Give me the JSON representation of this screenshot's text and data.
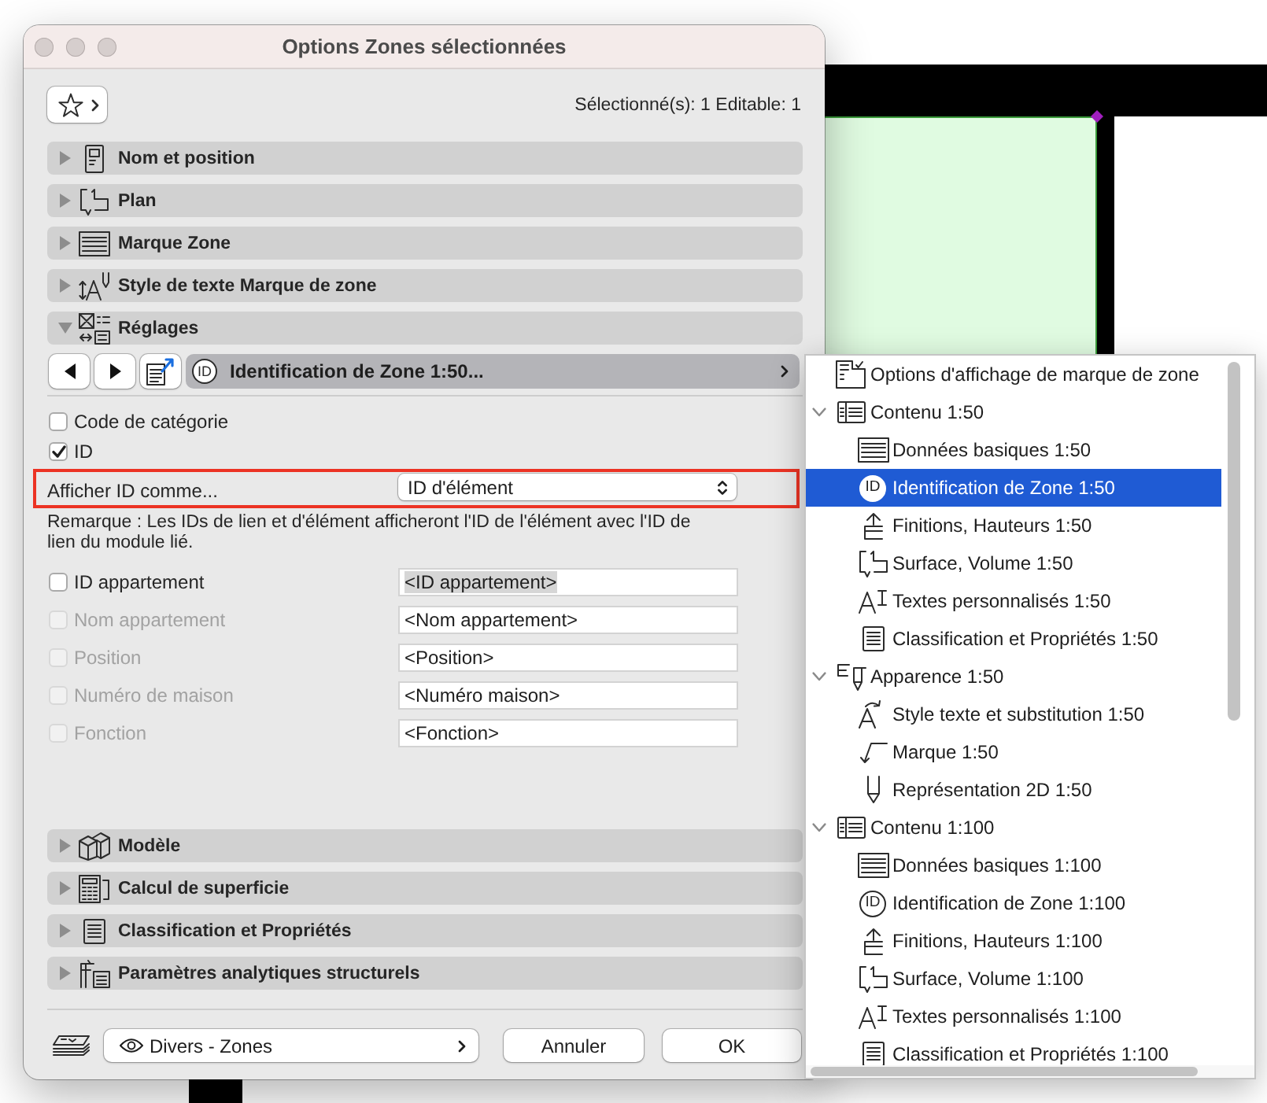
{
  "window": {
    "title": "Options Zones sélectionnées"
  },
  "toolbar": {
    "selection_info": "Sélectionné(s): 1 Editable: 1"
  },
  "sections": [
    {
      "label": "Nom et position",
      "kind": "name",
      "expanded": false
    },
    {
      "label": "Plan",
      "kind": "plan",
      "expanded": false
    },
    {
      "label": "Marque Zone",
      "kind": "marker",
      "expanded": false
    },
    {
      "label": "Style de texte Marque de zone",
      "kind": "textstyle",
      "expanded": false
    },
    {
      "label": "Réglages",
      "kind": "settings",
      "expanded": true,
      "panel": {
        "breadcrumb": {
          "badge": "ID",
          "label": "Identification de Zone 1:50..."
        },
        "options": [
          {
            "label": "Code de catégorie",
            "checked": false
          },
          {
            "label": "ID",
            "checked": true
          }
        ],
        "display_id": {
          "label": "Afficher ID comme...",
          "value": "ID d'élément",
          "highlighted": true
        },
        "note": "Remarque : Les IDs de lien et d'élément afficheront l'ID de l'élément avec l'ID de lien du module lié.",
        "fields": [
          {
            "label": "ID appartement",
            "checked": false,
            "disabled": false,
            "value": "<ID appartement>",
            "value_selected": true
          },
          {
            "label": "Nom appartement",
            "checked": false,
            "disabled": true,
            "value": "<Nom appartement>",
            "value_selected": false
          },
          {
            "label": "Position",
            "checked": false,
            "disabled": true,
            "value": "<Position>",
            "value_selected": false
          },
          {
            "label": "Numéro de maison",
            "checked": false,
            "disabled": true,
            "value": "<Numéro maison>",
            "value_selected": false
          },
          {
            "label": "Fonction",
            "checked": false,
            "disabled": true,
            "value": "<Fonction>",
            "value_selected": false
          }
        ]
      }
    },
    {
      "label": "Modèle",
      "kind": "model",
      "expanded": false
    },
    {
      "label": "Calcul de superficie",
      "kind": "area",
      "expanded": false
    },
    {
      "label": "Classification et Propriétés",
      "kind": "classification",
      "expanded": false
    },
    {
      "label": "Paramètres analytiques structurels",
      "kind": "structural",
      "expanded": false
    }
  ],
  "footer": {
    "view": "Divers - Zones",
    "buttons": [
      "Annuler",
      "OK"
    ]
  },
  "popup": {
    "items": [
      {
        "label": "Options d'affichage de marque de zone",
        "kind": "options",
        "selected": false
      },
      {
        "label": "Contenu 1:50",
        "kind": "content",
        "expanded": true,
        "selected": false,
        "children": [
          {
            "label": "Données basiques 1:50",
            "kind": "data",
            "selected": false
          },
          {
            "label": "Identification de Zone 1:50",
            "kind": "identification",
            "badge": "ID",
            "selected": true
          },
          {
            "label": "Finitions, Hauteurs 1:50",
            "kind": "finishes",
            "selected": false
          },
          {
            "label": "Surface, Volume 1:50",
            "kind": "surface",
            "selected": false
          },
          {
            "label": "Textes personnalisés 1:50",
            "kind": "texts",
            "selected": false
          },
          {
            "label": "Classification et Propriétés 1:50",
            "kind": "classification",
            "selected": false
          }
        ]
      },
      {
        "label": "Apparence 1:50",
        "kind": "appearance",
        "expanded": true,
        "selected": false,
        "children": [
          {
            "label": "Style texte et substitution 1:50",
            "kind": "substitution",
            "selected": false
          },
          {
            "label": "Marque 1:50",
            "kind": "marker",
            "selected": false
          },
          {
            "label": "Représentation 2D 1:50",
            "kind": "representation",
            "selected": false
          }
        ]
      },
      {
        "label": "Contenu 1:100",
        "kind": "content",
        "expanded": true,
        "selected": false,
        "children": [
          {
            "label": "Données basiques 1:100",
            "kind": "data",
            "selected": false
          },
          {
            "label": "Identification de Zone 1:100",
            "kind": "identification",
            "badge": "ID",
            "selected": false
          },
          {
            "label": "Finitions, Hauteurs 1:100",
            "kind": "finishes",
            "selected": false
          },
          {
            "label": "Surface, Volume 1:100",
            "kind": "surface",
            "selected": false
          },
          {
            "label": "Textes personnalisés 1:100",
            "kind": "texts",
            "selected": false
          },
          {
            "label": "Classification et Propriétés 1:100",
            "kind": "classification",
            "selected": false
          }
        ]
      }
    ]
  }
}
